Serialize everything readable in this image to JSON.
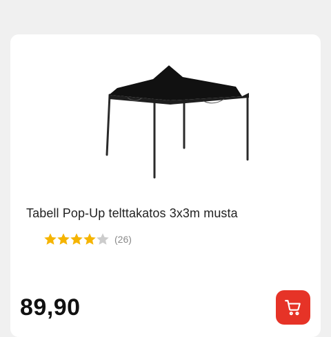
{
  "product": {
    "title": "Tabell Pop-Up telttakatos 3x3m musta",
    "rating": 4,
    "rating_max": 5,
    "review_count": "(26)",
    "price": "89,90",
    "image_icon": "pop-up-canopy-tent-image"
  },
  "actions": {
    "cart_icon": "shopping-cart-icon"
  },
  "colors": {
    "accent": "#e63327",
    "star_filled": "#f5b400",
    "star_empty": "#cccccc",
    "card_background": "#ffffff",
    "page_background": "#f0f0f0"
  }
}
